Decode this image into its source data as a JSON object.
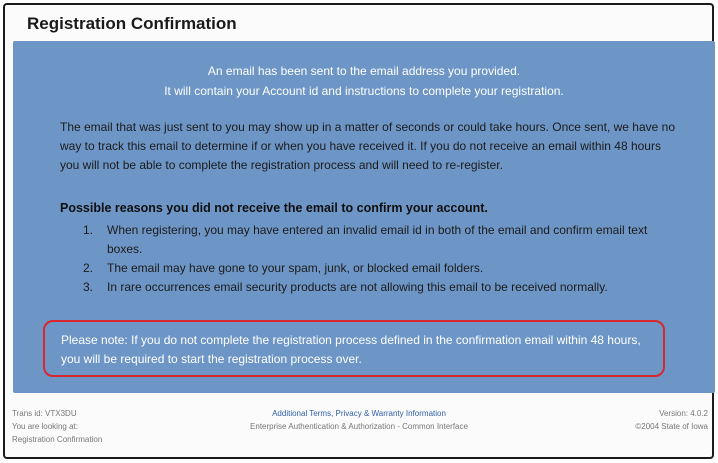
{
  "title": "Registration Confirmation",
  "intro": {
    "line1": "An email has been sent to the email address you provided.",
    "line2": "It will contain your Account id and instructions to complete your registration."
  },
  "body": "The email that was just sent to you may show up in a matter of seconds or could take hours. Once sent, we have no way to track this email to determine if or when you have received it. If you do not receive an email within 48 hours you will not be able to complete the registration process and will need to re-register.",
  "reasons": {
    "heading": "Possible reasons you did not receive the email to confirm your account.",
    "items": [
      {
        "num": "1.",
        "text": "When registering, you may have entered an invalid email id in both of the email and confirm email text boxes."
      },
      {
        "num": "2.",
        "text": "The email may have gone to your spam, junk, or blocked email folders."
      },
      {
        "num": "3.",
        "text": "In rare occurrences email security products are not allowing this email to be received normally."
      }
    ]
  },
  "note": "Please note: If you do not complete the registration process defined in the confirmation email within 48 hours, you will be required to start the registration process over.",
  "footer": {
    "left_line1": "Trans id: VTX3DU",
    "left_line2": "You are looking at:",
    "left_line3": "Registration Confirmation",
    "center_link": "Additional Terms, Privacy & Warranty Information",
    "center_line2": "Enterprise Authentication & Authorization - Common Interface",
    "right_line1": "Version: 4.0.2",
    "right_line2": "©2004 State of Iowa"
  },
  "colors": {
    "panel": "#6d96c6",
    "note_border": "#d9272f",
    "link": "#2f5fa8"
  }
}
